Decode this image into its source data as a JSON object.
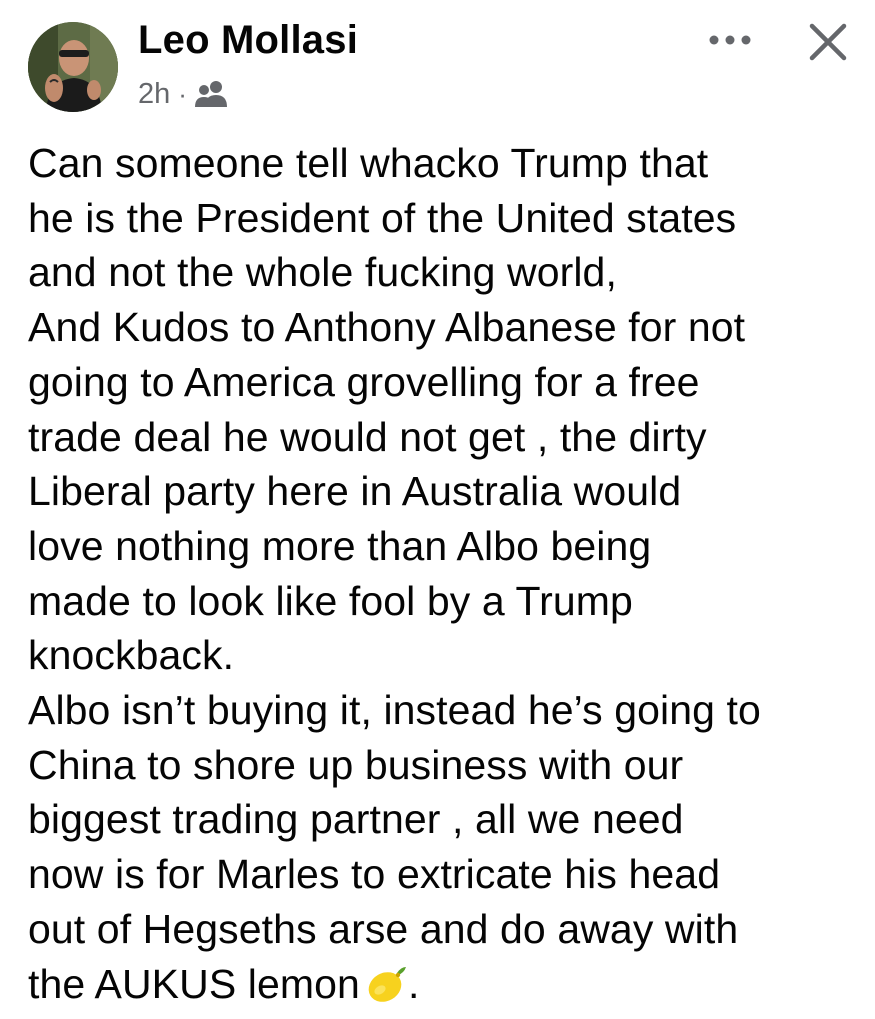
{
  "post": {
    "author": "Leo Mollasi",
    "timestamp": "2h",
    "separator": "·",
    "audience_icon": "friends-icon",
    "avatar_icon": "profile-photo",
    "more_icon": "more-horizontal-icon",
    "close_icon": "close-icon",
    "body_lines": [
      "Can someone tell whacko Trump that",
      "he is the President of the United states",
      "and not the whole fucking world,",
      "And Kudos to Anthony Albanese for not",
      "going to America grovelling for a free",
      "trade deal he would not get , the dirty",
      "Liberal party here in Australia would",
      "love nothing more than Albo being",
      "made to look like fool by a Trump",
      "knockback.",
      "Albo isn’t buying it, instead he’s going to",
      "China to shore up business with our",
      "biggest trading partner , all we need",
      "now is for Marles to extricate his head",
      "out of Hegseths arse and do away with"
    ],
    "last_line": {
      "text": "the AUKUS lemon",
      "emoji": "lemon-emoji",
      "trailing": "."
    }
  },
  "colors": {
    "text": "#050505",
    "secondary_text": "#65676b",
    "background": "#ffffff"
  }
}
